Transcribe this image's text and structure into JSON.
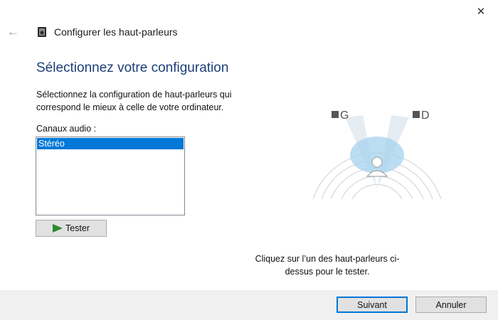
{
  "window": {
    "title": "Configurer les haut-parleurs",
    "close_glyph": "✕",
    "back_glyph": "←"
  },
  "main": {
    "heading": "Sélectionnez votre configuration",
    "description": "Sélectionnez la configuration de haut-parleurs qui correspond le mieux à celle de votre ordinateur.",
    "channels_label": "Canaux audio :",
    "channels": [
      {
        "label": "Stéréo",
        "selected": true
      }
    ],
    "test_button_label": "Tester"
  },
  "diagram": {
    "left_speaker_label": "G",
    "right_speaker_label": "D"
  },
  "hint": "Cliquez sur l’un des haut-parleurs ci-dessus pour le tester.",
  "footer": {
    "next_label": "Suivant",
    "cancel_label": "Annuler"
  },
  "colors": {
    "heading": "#1c3f78",
    "selection": "#0078d7",
    "play": "#2e8b2e"
  },
  "icons": {
    "close": "close-icon",
    "back": "back-arrow-icon",
    "title": "speaker-icon",
    "play": "play-icon"
  }
}
